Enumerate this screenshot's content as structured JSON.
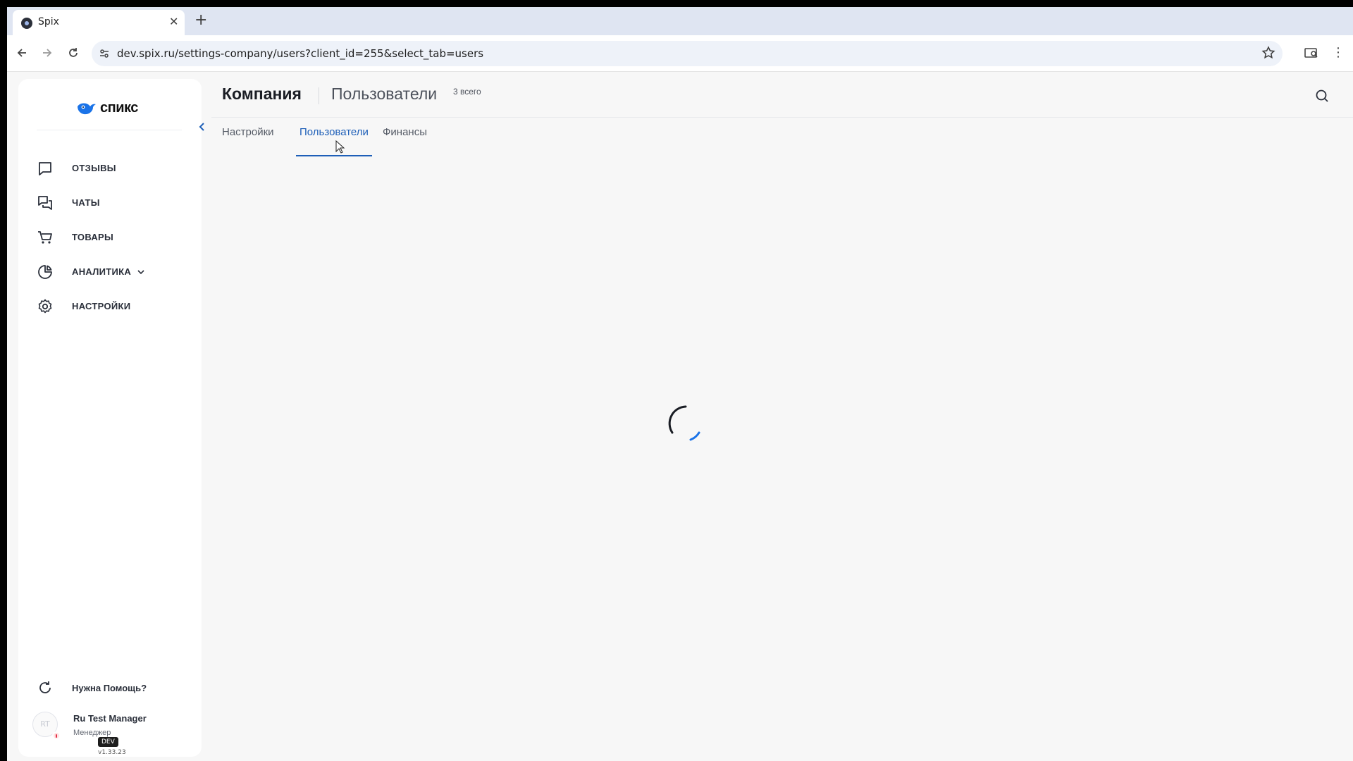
{
  "browser": {
    "tab_title": "Spix",
    "tab_close": "✕",
    "new_tab": "+",
    "url": "dev.spix.ru/settings-company/users?client_id=255&select_tab=users"
  },
  "sidebar": {
    "logo_text": "спикс",
    "nav": [
      {
        "label": "ОТЗЫВЫ",
        "icon": "reviews-icon"
      },
      {
        "label": "ЧАТЫ",
        "icon": "chats-icon"
      },
      {
        "label": "ТОВАРЫ",
        "icon": "cart-icon"
      },
      {
        "label": "АНАЛИТИКА",
        "icon": "analytics-icon"
      },
      {
        "label": "НАСТРОЙКИ",
        "icon": "gear-icon"
      }
    ],
    "help_label": "Нужна Помощь?",
    "user": {
      "initials": "RT",
      "name": "Ru Test Manager",
      "role": "Менеджер"
    },
    "env_badge": "DEV",
    "version": "v1.33.23"
  },
  "header": {
    "title": "Компания",
    "subtitle": "Пользователи",
    "count": "3 всего"
  },
  "tabs": [
    {
      "label": "Настройки"
    },
    {
      "label": "Пользователи"
    },
    {
      "label": "Финансы"
    }
  ],
  "active_tab": "Пользователи",
  "colors": {
    "accent": "#1e5fb8",
    "logo_blue": "#1a73e8",
    "background": "#f7f7f7"
  },
  "loading": true
}
